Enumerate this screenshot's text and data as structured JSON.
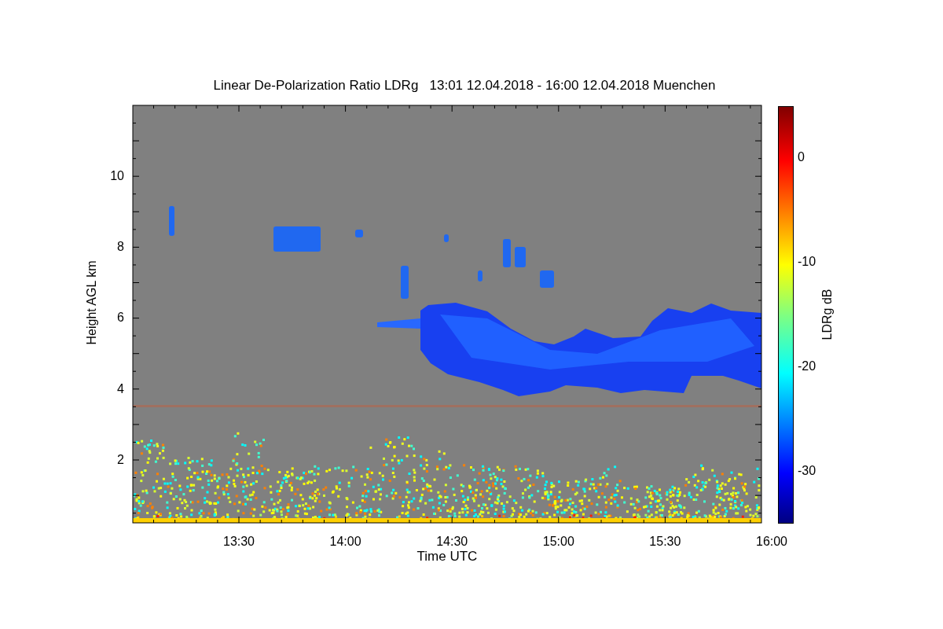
{
  "title": "Linear De-Polarization Ratio LDRg   13:01 12.04.2018 - 16:00 12.04.2018 Muenchen",
  "y_axis": {
    "label": "Height AGL km",
    "ticks": [
      "10",
      "8",
      "6",
      "4",
      "2"
    ]
  },
  "x_axis": {
    "label": "Time UTC",
    "ticks": [
      "13:30",
      "14:00",
      "14:30",
      "15:00",
      "15:30",
      "16:00"
    ]
  },
  "colorbar": {
    "label": "LDRg dB",
    "ticks": [
      "0",
      "-10",
      "-20",
      "-30"
    ]
  }
}
